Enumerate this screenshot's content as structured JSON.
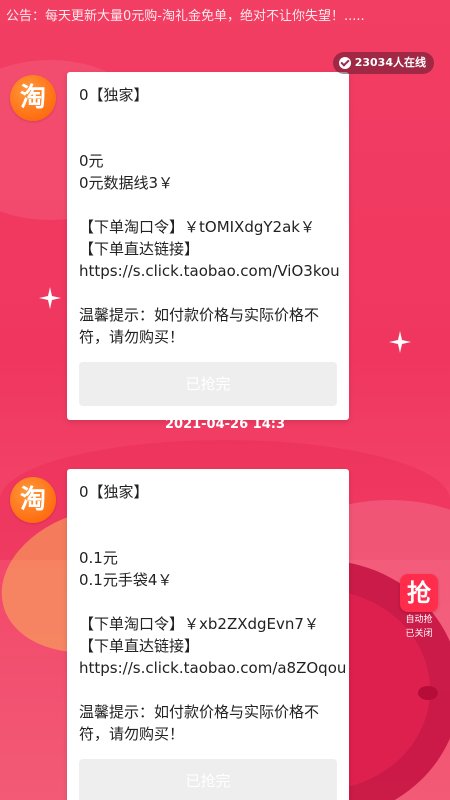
{
  "notice": "公告：每天更新大量0元购-淘礼金免单，绝对不让你失望！.....",
  "online_count": "23034人在线",
  "avatar_glyph": "淘",
  "posts": [
    {
      "title": "0【独家】",
      "price": "0元",
      "product": "0元数据线3￥",
      "code_line": "【下单淘口令】￥tOMIXdgY2ak￥",
      "link_label": "【下单直达链接】",
      "link_url": "https://s.click.taobao.com/ViO3kou",
      "tip_line1": "温馨提示：如付款价格与实际价格不",
      "tip_line2": "符，请勿购买！",
      "button": "已抢完"
    },
    {
      "title": "0【独家】",
      "price": "0.1元",
      "product": "0.1元手袋4￥",
      "code_line": "【下单淘口令】￥xb2ZXdgEvn7￥",
      "link_label": "【下单直达链接】",
      "link_url": "https://s.click.taobao.com/a8ZOqou",
      "tip_line1": "温馨提示：如付款价格与实际价格不",
      "tip_line2": "符，请勿购买！",
      "button": "已抢完"
    }
  ],
  "timestamp": "2021-04-26 14:3",
  "auto_grab": {
    "glyph": "抢",
    "line1": "自动抢",
    "line2": "已关闭"
  },
  "colors": {
    "background": "#f0365f",
    "avatar": "#ff6a10",
    "grab_button": "#ff2d4b",
    "disabled_button": "#eeeeee"
  },
  "icons": [
    "check-icon",
    "sparkle-icon",
    "taobao-avatar-icon"
  ]
}
